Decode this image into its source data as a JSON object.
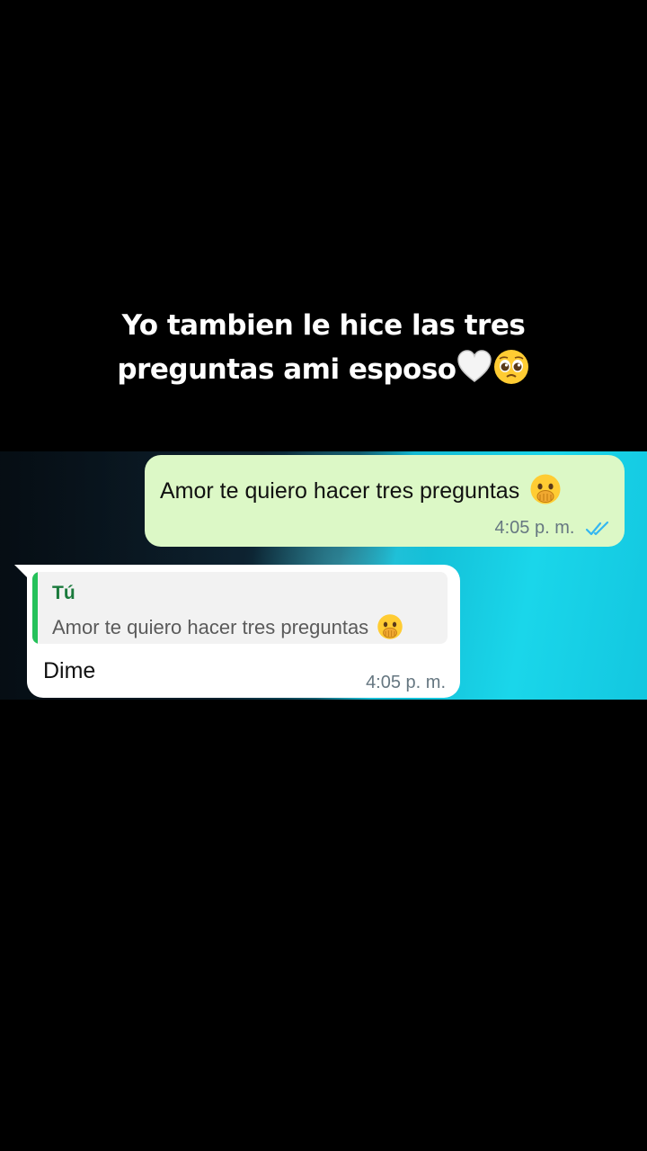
{
  "caption": {
    "line1": "Yo tambien le hice las tres",
    "line2": "preguntas ami esposo"
  },
  "caption_emojis": [
    "white-heart-emoji",
    "pleading-face-emoji"
  ],
  "chat": {
    "outgoing": {
      "text": "Amor te quiero hacer tres preguntas",
      "time": "4:05 p. m.",
      "status": "read",
      "status_color": "#34b7f1",
      "bubble_color": "#dcf8c6"
    },
    "incoming": {
      "quote_author": "Tú",
      "quote_text": "Amor te quiero hacer tres preguntas",
      "quote_bar_color": "#25c15a",
      "reply_text": "Dime",
      "time": "4:05 p. m.",
      "bubble_color": "#ffffff"
    }
  }
}
